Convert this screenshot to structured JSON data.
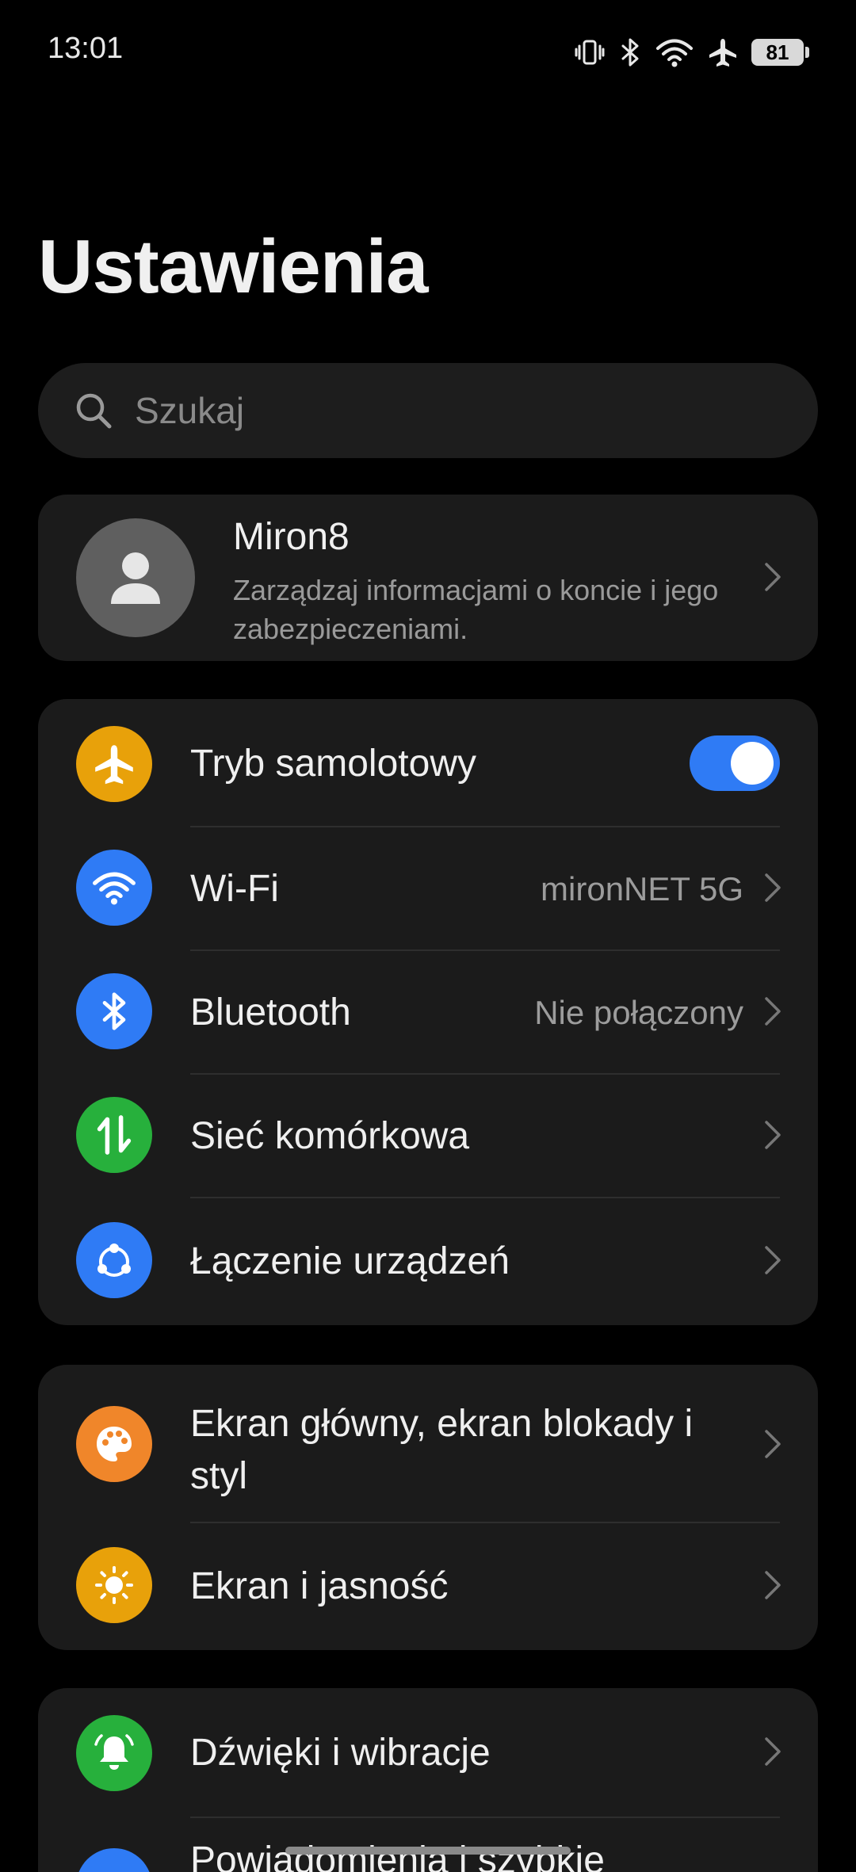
{
  "status_bar": {
    "time": "13:01",
    "battery": "81"
  },
  "page": {
    "title": "Ustawienia"
  },
  "search": {
    "placeholder": "Szukaj"
  },
  "account": {
    "name": "Miron8",
    "subtitle": "Zarządzaj informacjami o koncie i jego zabezpieczeniami."
  },
  "connectivity": {
    "airplane": {
      "label": "Tryb samolotowy",
      "enabled": true,
      "icon": "airplane-icon",
      "color": "#e8a10a"
    },
    "wifi": {
      "label": "Wi-Fi",
      "value": "mironNET 5G",
      "icon": "wifi-icon",
      "color": "#2f7bf5"
    },
    "bluetooth": {
      "label": "Bluetooth",
      "value": "Nie połączony",
      "icon": "bluetooth-icon",
      "color": "#2f7bf5"
    },
    "mobile": {
      "label": "Sieć komórkowa",
      "icon": "mobile-data-icon",
      "color": "#27b03c"
    },
    "connections": {
      "label": "Łączenie urządzeń",
      "icon": "device-connect-icon",
      "color": "#2f7bf5"
    }
  },
  "display": {
    "home_style": {
      "label_line1": "Ekran główny, ekran blokady i",
      "label_line2": "styl",
      "icon": "palette-icon",
      "color": "#f0862a"
    },
    "brightness": {
      "label": "Ekran i jasność",
      "icon": "brightness-icon",
      "color": "#e8a10a"
    }
  },
  "sound": {
    "sounds": {
      "label": "Dźwięki i wibracje",
      "icon": "bell-icon",
      "color": "#27b03c"
    },
    "notifications": {
      "label": "Powiadomienia i szybkie",
      "icon": "notifications-icon",
      "color": "#2f7bf5"
    }
  }
}
